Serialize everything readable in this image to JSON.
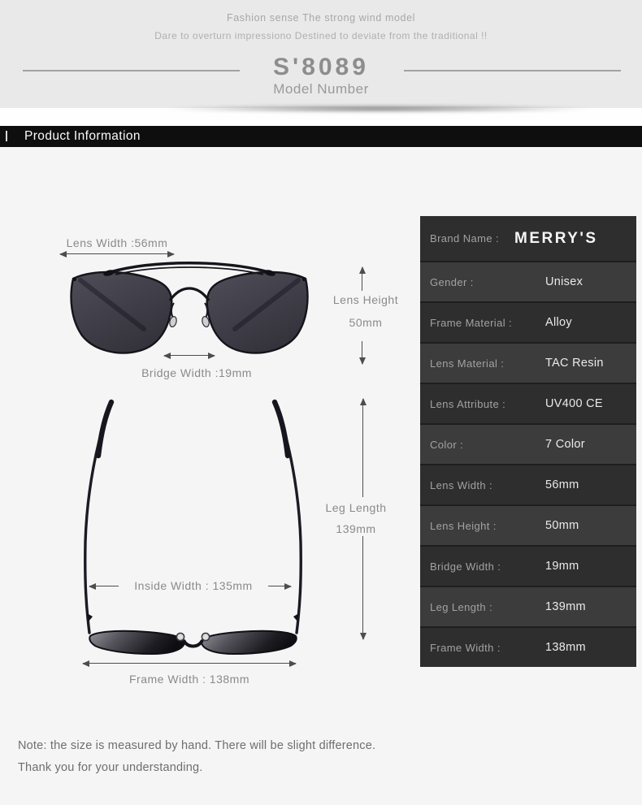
{
  "header": {
    "tagline1": "Fashion sense The strong wind model",
    "tagline2": "Dare to overturn impressiono Destined to deviate from the traditional !!",
    "model_number": "S'8089",
    "model_caption": "Model Number"
  },
  "section_bar": {
    "title": "Product Information"
  },
  "diagram": {
    "front_view": {
      "lens_width_label": "Lens Width :56mm",
      "lens_height_label_line1": "Lens Height",
      "lens_height_label_line2": "50mm",
      "bridge_width_label": "Bridge Width :19mm"
    },
    "top_view": {
      "leg_length_label_line1": "Leg Length",
      "leg_length_label_line2": "139mm",
      "inside_width_label": "Inside  Width : 135mm",
      "frame_width_label": "Frame Width : 138mm"
    }
  },
  "spec_table": {
    "rows": [
      {
        "label": "Brand Name :",
        "value": "MERRY'S"
      },
      {
        "label": "Gender :",
        "value": "Unisex"
      },
      {
        "label": "Frame Material :",
        "value": "Alloy"
      },
      {
        "label": "Lens Material :",
        "value": "TAC Resin"
      },
      {
        "label": "Lens Attribute :",
        "value": "UV400 CE"
      },
      {
        "label": "Color :",
        "value": "7  Color"
      },
      {
        "label": "Lens Width :",
        "value": "56mm"
      },
      {
        "label": "Lens Height :",
        "value": "50mm"
      },
      {
        "label": "Bridge Width :",
        "value": "19mm"
      },
      {
        "label": "Leg Length :",
        "value": "139mm"
      },
      {
        "label": "Frame Width :",
        "value": "138mm"
      }
    ]
  },
  "note": {
    "line1": "Note:  the size is measured by hand. There will be slight difference.",
    "line2": "Thank you for your understanding."
  },
  "colors": {
    "header_bg": "#e9e9e9",
    "page_bg": "#f5f5f5",
    "section_bar_bg": "#0e0e0e",
    "section_bar_text": "#fafafa",
    "table_row_dark": "#2e2e2e",
    "table_row_light": "#3c3c3c",
    "table_label_text": "#a2a2a2",
    "table_value_text": "#eaeaea",
    "diagram_text": "#8a8a8a",
    "arrow": "#4d4d4d",
    "note_text": "#6e6e6e"
  }
}
